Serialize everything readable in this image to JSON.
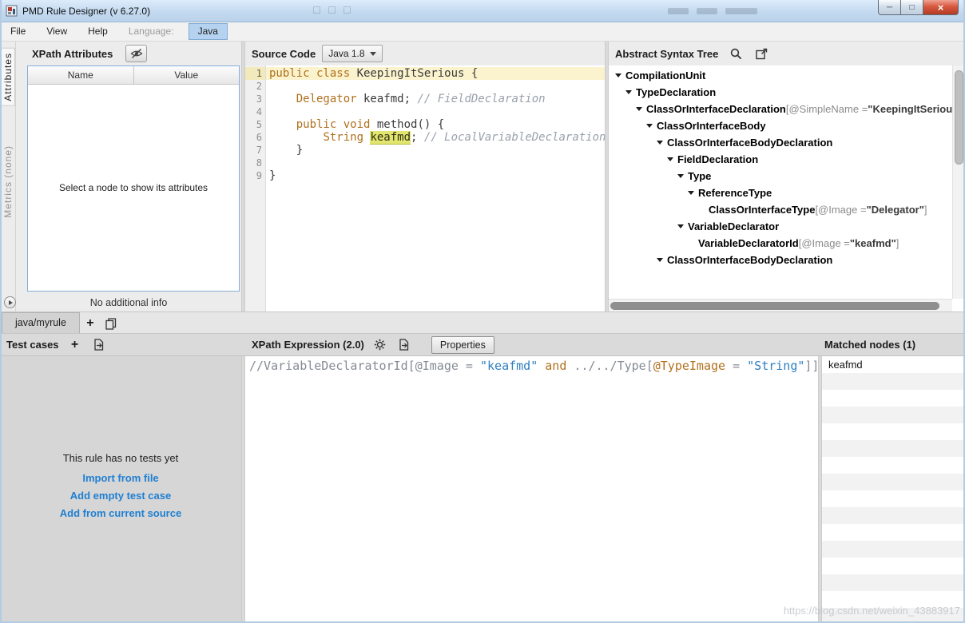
{
  "window": {
    "title": "PMD Rule Designer (v 6.27.0)",
    "controls": {
      "minimize": "─",
      "maximize": "□",
      "close": "×"
    }
  },
  "menu": {
    "items": [
      {
        "label": "File"
      },
      {
        "label": "View"
      },
      {
        "label": "Help"
      },
      {
        "label": "Language:",
        "muted": true
      },
      {
        "label": "Java",
        "selected": true
      }
    ]
  },
  "side_tabs": {
    "attributes": "Attributes",
    "metrics": "Metrics (none)"
  },
  "attributes_panel": {
    "title": "XPath Attributes",
    "columns": [
      "Name",
      "Value"
    ],
    "placeholder": "Select a node to show its attributes",
    "footer": "No additional info"
  },
  "source_panel": {
    "title": "Source Code",
    "language_version": "Java 1.8",
    "lines": [
      {
        "num": "1",
        "highlighted": true,
        "segments": [
          {
            "text": "public class ",
            "style": "kw"
          },
          {
            "text": "KeepingItSerious {",
            "style": "plain"
          }
        ]
      },
      {
        "num": "2",
        "segments": []
      },
      {
        "num": "3",
        "segments": [
          {
            "text": "    ",
            "style": "plain"
          },
          {
            "text": "Delegator",
            "style": "kw"
          },
          {
            "text": " keafmd; ",
            "style": "plain"
          },
          {
            "text": "// FieldDeclaration",
            "style": "comment"
          }
        ]
      },
      {
        "num": "4",
        "segments": []
      },
      {
        "num": "5",
        "segments": [
          {
            "text": "    ",
            "style": "plain"
          },
          {
            "text": "public void",
            "style": "kw"
          },
          {
            "text": " method() {",
            "style": "plain"
          }
        ]
      },
      {
        "num": "6",
        "segments": [
          {
            "text": "        ",
            "style": "plain"
          },
          {
            "text": "String",
            "style": "kw"
          },
          {
            "text": " ",
            "style": "plain"
          },
          {
            "text": "keafmd",
            "style": "mark"
          },
          {
            "text": "; ",
            "style": "plain"
          },
          {
            "text": "// LocalVariableDeclaration",
            "style": "comment"
          }
        ]
      },
      {
        "num": "7",
        "segments": [
          {
            "text": "    }",
            "style": "plain"
          }
        ]
      },
      {
        "num": "8",
        "segments": []
      },
      {
        "num": "9",
        "segments": [
          {
            "text": "}",
            "style": "plain"
          }
        ]
      }
    ]
  },
  "ast_panel": {
    "title": "Abstract Syntax Tree",
    "nodes": [
      {
        "depth": 0,
        "expander": true,
        "label": "CompilationUnit"
      },
      {
        "depth": 1,
        "expander": true,
        "label": "TypeDeclaration"
      },
      {
        "depth": 2,
        "expander": true,
        "label": "ClassOrInterfaceDeclaration",
        "attr": {
          "pre": "[@SimpleName = ",
          "val": "\"KeepingItSerious\"",
          "post": "]"
        }
      },
      {
        "depth": 3,
        "expander": true,
        "label": "ClassOrInterfaceBody"
      },
      {
        "depth": 4,
        "expander": true,
        "label": "ClassOrInterfaceBodyDeclaration"
      },
      {
        "depth": 5,
        "expander": true,
        "label": "FieldDeclaration"
      },
      {
        "depth": 6,
        "expander": true,
        "label": "Type"
      },
      {
        "depth": 7,
        "expander": true,
        "label": "ReferenceType"
      },
      {
        "depth": 8,
        "expander": false,
        "label": "ClassOrInterfaceType",
        "attr": {
          "pre": "[@Image = ",
          "val": "\"Delegator\"",
          "post": "]"
        }
      },
      {
        "depth": 6,
        "expander": true,
        "label": "VariableDeclarator"
      },
      {
        "depth": 7,
        "expander": false,
        "label": "VariableDeclaratorId",
        "attr": {
          "pre": "[@Image = ",
          "val": "\"keafmd\"",
          "post": "]"
        }
      },
      {
        "depth": 4,
        "expander": true,
        "label": "ClassOrInterfaceBodyDeclaration"
      }
    ]
  },
  "rule_tab": {
    "label": "java/myrule",
    "add_label": "+"
  },
  "test_cases": {
    "title": "Test cases",
    "add_label": "+",
    "empty_message": "This rule has no tests yet",
    "links": [
      "Import from file",
      "Add empty test case",
      "Add from current source"
    ]
  },
  "xpath_panel": {
    "title": "XPath Expression (2.0)",
    "properties_button": "Properties",
    "expression": [
      {
        "text": "//VariableDeclaratorId[@Image = ",
        "style": "plain"
      },
      {
        "text": "\"keafmd\"",
        "style": "string"
      },
      {
        "text": " ",
        "style": "plain"
      },
      {
        "text": "and",
        "style": "kw"
      },
      {
        "text": " ../../Type[",
        "style": "plain"
      },
      {
        "text": "@TypeImage",
        "style": "attr"
      },
      {
        "text": " = ",
        "style": "plain"
      },
      {
        "text": "\"String\"",
        "style": "string"
      },
      {
        "text": "]]",
        "style": "plain"
      }
    ]
  },
  "matched_nodes": {
    "title": "Matched nodes (1)",
    "items": [
      "keafmd"
    ]
  },
  "watermark": "https://blog.csdn.net/weixin_43883917"
}
